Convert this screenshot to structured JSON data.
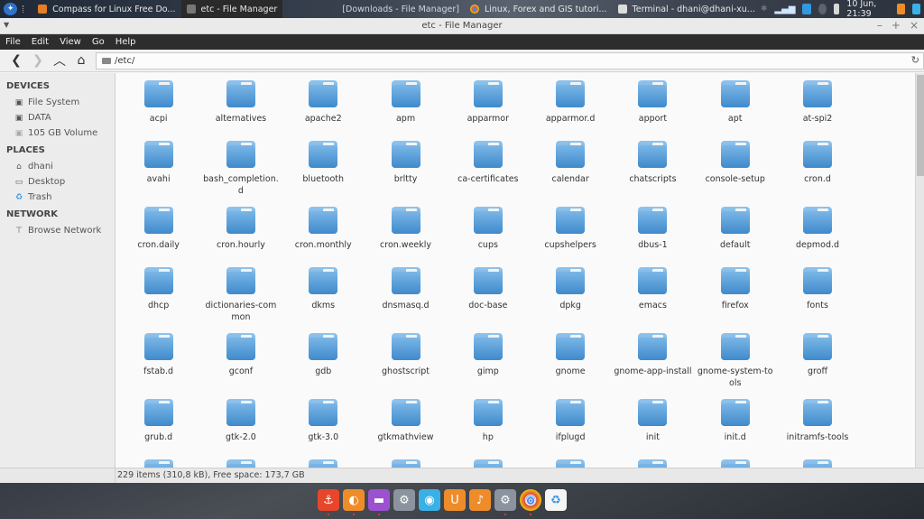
{
  "top_panel": {
    "tasks": [
      {
        "label": "Compass for Linux Free Do...",
        "icon": "firefox-icon",
        "color": "#e67e22",
        "active": false,
        "minimized": false
      },
      {
        "label": "etc - File Manager",
        "icon": "file-manager-icon",
        "color": "#888888",
        "active": true,
        "minimized": false
      },
      {
        "label": "[Downloads - File Manager]",
        "icon": "",
        "color": "",
        "active": false,
        "minimized": true
      },
      {
        "label": "Linux, Forex and GIS tutori...",
        "icon": "chrome-icon",
        "color": "#dd4b39",
        "active": false,
        "minimized": false
      },
      {
        "label": "Terminal - dhani@dhani-xu...",
        "icon": "terminal-icon",
        "color": "#dddddd",
        "active": false,
        "minimized": false
      }
    ],
    "clock": "10 Jun, 21:39"
  },
  "window": {
    "title": "etc - File Manager",
    "menu": [
      "File",
      "Edit",
      "View",
      "Go",
      "Help"
    ],
    "location": "/etc/"
  },
  "sidebar": {
    "sections": [
      {
        "title": "DEVICES",
        "items": [
          {
            "label": "File System",
            "icon": "drive-icon"
          },
          {
            "label": "DATA",
            "icon": "drive-icon"
          },
          {
            "label": "105 GB Volume",
            "icon": "drive-icon"
          }
        ]
      },
      {
        "title": "PLACES",
        "items": [
          {
            "label": "dhani",
            "icon": "home-icon"
          },
          {
            "label": "Desktop",
            "icon": "desktop-icon"
          },
          {
            "label": "Trash",
            "icon": "trash-icon"
          }
        ]
      },
      {
        "title": "NETWORK",
        "items": [
          {
            "label": "Browse Network",
            "icon": "network-icon"
          }
        ]
      }
    ]
  },
  "files": [
    "acpi",
    "alternatives",
    "apache2",
    "apm",
    "apparmor",
    "apparmor.d",
    "apport",
    "apt",
    "at-spi2",
    "avahi",
    "bash_completion.d",
    "bluetooth",
    "brltty",
    "ca-certificates",
    "calendar",
    "chatscripts",
    "console-setup",
    "cron.d",
    "cron.daily",
    "cron.hourly",
    "cron.monthly",
    "cron.weekly",
    "cups",
    "cupshelpers",
    "dbus-1",
    "default",
    "depmod.d",
    "dhcp",
    "dictionaries-common",
    "dkms",
    "dnsmasq.d",
    "doc-base",
    "dpkg",
    "emacs",
    "firefox",
    "fonts",
    "fstab.d",
    "gconf",
    "gdb",
    "ghostscript",
    "gimp",
    "gnome",
    "gnome-app-install",
    "gnome-system-tools",
    "groff",
    "grub.d",
    "gtk-2.0",
    "gtk-3.0",
    "gtkmathview",
    "hp",
    "ifplugd",
    "init",
    "init.d",
    "initramfs-tools",
    "",
    "",
    "",
    "",
    "",
    "",
    "",
    "",
    ""
  ],
  "status": "229 items (310,8 kB), Free space: 173,7 GB",
  "dock": [
    {
      "name": "anchor-icon",
      "color": "#e8462a",
      "glyph": "⚓",
      "running": true
    },
    {
      "name": "firefox-icon",
      "color": "#ef8c2a",
      "glyph": "◐",
      "running": true
    },
    {
      "name": "chat-icon",
      "color": "#9b51d0",
      "glyph": "▬",
      "running": true
    },
    {
      "name": "settings-icon",
      "color": "#8b949e",
      "glyph": "⚙",
      "running": false
    },
    {
      "name": "camera-icon",
      "color": "#3ab0e6",
      "glyph": "◉",
      "running": false
    },
    {
      "name": "store-icon",
      "color": "#ef8c2a",
      "glyph": "U",
      "running": false
    },
    {
      "name": "music-icon",
      "color": "#ef8c2a",
      "glyph": "♪",
      "running": false
    },
    {
      "name": "settings-icon",
      "color": "#8b949e",
      "glyph": "⚙",
      "running": true
    },
    {
      "name": "chrome-icon",
      "color": "#dd4b39",
      "glyph": "◎",
      "running": true
    },
    {
      "name": "trash-icon",
      "color": "#f5f5f5",
      "glyph": "♻",
      "running": false
    }
  ]
}
